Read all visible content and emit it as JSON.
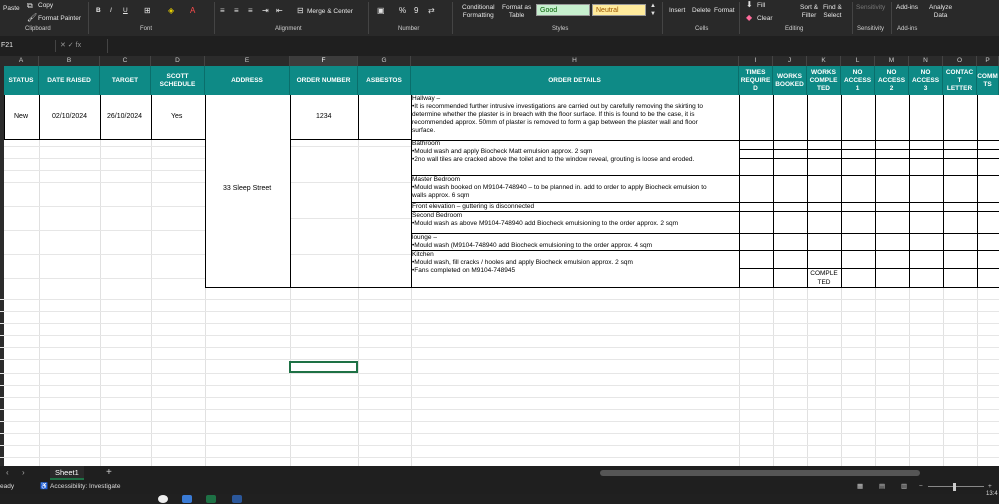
{
  "ribbon": {
    "paste": "Paste",
    "copy": "Copy",
    "format_painter": "Format Painter",
    "clipboard": "Clipboard",
    "font_group": "Font",
    "bold": "B",
    "italic": "I",
    "underline": "U",
    "alignment_group": "Alignment",
    "merge_center": "Merge & Center",
    "number_group": "Number",
    "percent": "%",
    "comma": "9",
    "conditional_formatting": "Conditional\nFormatting",
    "format_as_table": "Format as\nTable",
    "style_good": "Good",
    "style_neutral": "Neutral",
    "styles_group": "Styles",
    "insert": "Insert",
    "delete": "Delete",
    "format": "Format",
    "cells_group": "Cells",
    "fill": "Fill",
    "clear": "Clear",
    "sort_filter": "Sort &\nFilter",
    "find_select": "Find &\nSelect",
    "editing_group": "Editing",
    "sensitivity": "Sensitivity",
    "sensitivity_group": "Sensitivity",
    "add_ins": "Add-ins",
    "add_ins_group": "Add-ins",
    "analyze_data": "Analyze\nData",
    "color_good_bg": "#c6efce",
    "color_neutral_bg": "#ffeb9c"
  },
  "formula_bar": {
    "name_box": "F21",
    "icons": "✕  ✓  fx"
  },
  "columns": [
    "A",
    "B",
    "C",
    "D",
    "E",
    "F",
    "G",
    "H",
    "I",
    "J",
    "K",
    "L",
    "M",
    "N",
    "O",
    "P"
  ],
  "headers": {
    "status": "STATUS",
    "date_raised": "DATE RAISED",
    "target": "TARGET",
    "scott_schedule": "SCOTT SCHEDULE",
    "address": "ADDRESS",
    "order_number": "ORDER NUMBER",
    "asbestos": "ASBESTOS",
    "order_details": "ORDER DETAILS",
    "times_required": "TIMES REQUIRE D",
    "works_booked": "WORKS BOOKED",
    "works_completed": "WORKS COMPLE TED",
    "no_access_1": "NO ACCESS 1",
    "no_access_2": "NO ACCESS 2",
    "no_access_3": "NO ACCESS 3",
    "contact_letter": "CONTAC T LETTER",
    "comments": "COMM TS"
  },
  "header_color": "#0e8a86",
  "row": {
    "status": "New",
    "date_raised": "02/10/2024",
    "target": "26/10/2024",
    "scott_schedule": "Yes",
    "address": "33 Sleep Street",
    "order_number": "1234",
    "works_completed": "COMPLE\nTED"
  },
  "details": {
    "hallway": [
      "Hallway –",
      "•It is recommended further intrusive investigations are carried out by carefully removing the skirting to",
      "determine whether the plaster is in breach with the floor surface. If this is found to be the case, it is",
      "recommended approx. 50mm of plaster is removed to form a gap between the plaster wall and floor",
      "surface."
    ],
    "bathroom": [
      "Bathroom",
      "•Mould wash and apply Biocheck Matt emulsion approx. 2 sqm",
      "•2no wall tiles are cracked above the toilet and to the window reveal, grouting is loose and eroded."
    ],
    "master_bedroom": [
      "Master Bedroom",
      "•Mould wash booked on M9104-748940 – to be planned in. add to order to apply Biocheck emulsion to",
      "walls approx. 6 sqm"
    ],
    "front_elevation": [
      "Front elevation – guttering is disconnected"
    ],
    "second_bedroom": [
      "Second Bedroom",
      "•Mould wash as above M9104-748940 add Biocheck emulsioning to the order approx. 2 sqm"
    ],
    "lounge": [
      "lounge –",
      "•Mould wash (M9104-748940 add Biocheck emulsioning to the order approx. 4 sqm"
    ],
    "kitchen": [
      "Kitchen",
      "•Mould wash, fill cracks / hooles and apply Biocheck emulsion approx. 2 sqm",
      "•Fans completed on M9104-748945"
    ]
  },
  "sheet_tab": "Sheet1",
  "status_bar": {
    "ready": "eady",
    "accessibility": "Accessibility: Investigate",
    "time": "13:4"
  }
}
